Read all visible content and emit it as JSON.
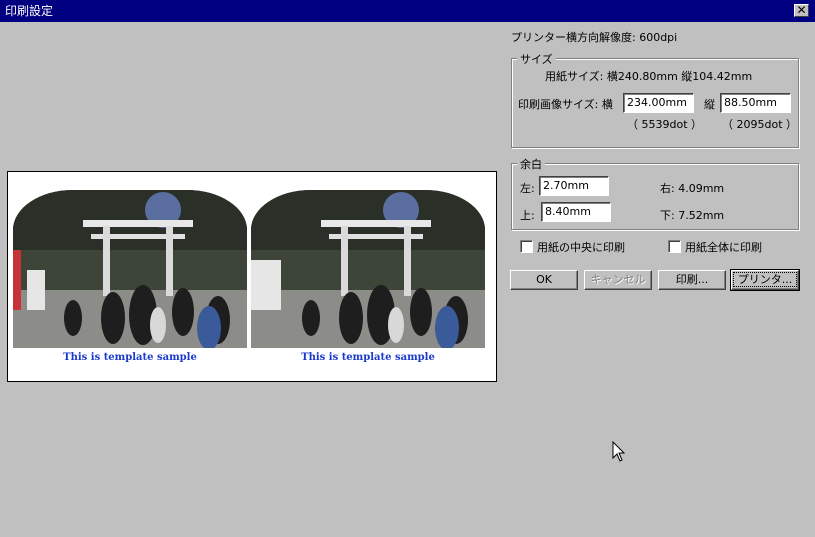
{
  "window": {
    "title": "印刷設定",
    "close_label": "✕"
  },
  "resolution_label": "プリンター横方向解像度: 600dpi",
  "size_group": {
    "legend": "サイズ",
    "paper_size": "用紙サイズ: 横240.80mm 縦104.42mm",
    "image_size_label": "印刷画像サイズ: 横",
    "width_value": "234.00mm",
    "height_label": "縦",
    "height_value": "88.50mm",
    "width_dots": "（ 5539dot ）",
    "height_dots": "（ 2095dot ）"
  },
  "margin_group": {
    "legend": "余白",
    "left_label": "左:",
    "left_value": "2.70mm",
    "top_label": "上:",
    "top_value": "8.40mm",
    "right_text": "右: 4.09mm",
    "bottom_text": "下: 7.52mm"
  },
  "options": {
    "center_label": "用紙の中央に印刷",
    "center_checked": false,
    "fill_label": "用紙全体に印刷",
    "fill_checked": false
  },
  "buttons": {
    "ok": "OK",
    "cancel": "キャンセル",
    "print": "印刷...",
    "printer": "プリンタ..."
  },
  "preview": {
    "captions": [
      "This is template sample",
      "This is template sample"
    ]
  },
  "colors": {
    "titlebar": "#000080",
    "dialog": "#c0c0c0",
    "caption": "#1a3acc"
  }
}
